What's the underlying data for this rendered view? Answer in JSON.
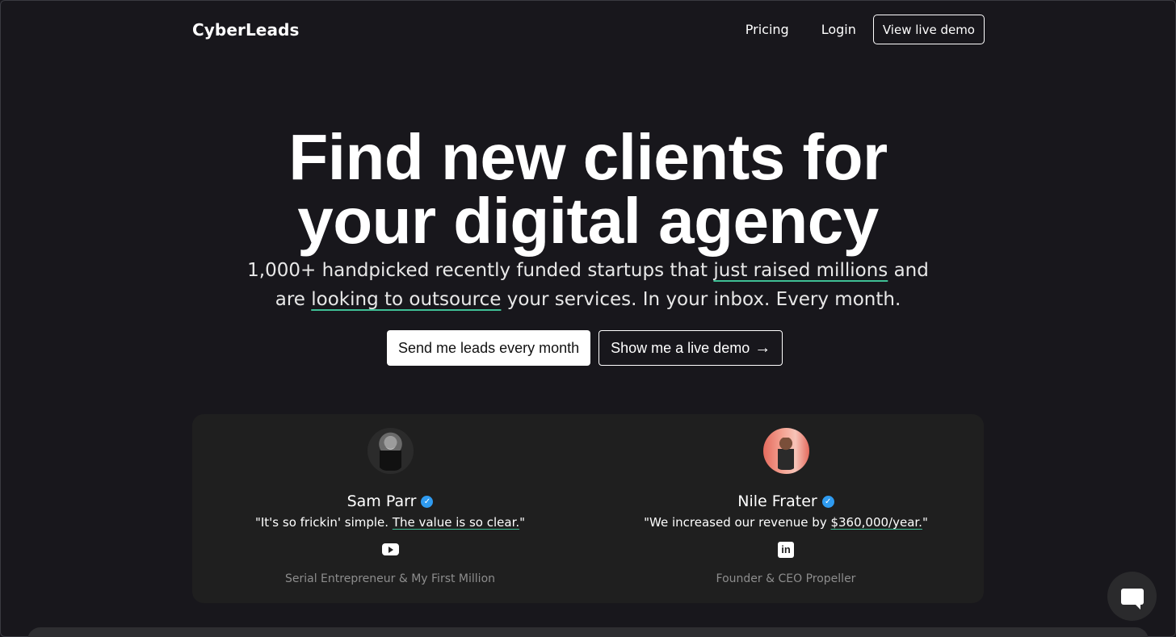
{
  "header": {
    "logo": "CyberLeads",
    "nav": [
      {
        "label": "Pricing"
      },
      {
        "label": "Login"
      }
    ],
    "demo_button": "View live demo"
  },
  "hero": {
    "title_line1": "Find new clients for",
    "title_line2": "your digital agency",
    "sub_part1": "1,000+ handpicked recently funded startups that ",
    "sub_highlight1": "just raised millions",
    "sub_part2": " and",
    "sub_part3": "are ",
    "sub_highlight2": "looking to outsource",
    "sub_part4": " your services. In your inbox. Every month.",
    "primary_cta": "Send me leads every month",
    "secondary_cta": "Show me a live demo",
    "secondary_cta_icon": "arrow-right-icon"
  },
  "testimonials": [
    {
      "name": "Sam Parr",
      "quote_start": "\"It's so frickin' simple. ",
      "quote_highlight": "The value is so clear.",
      "quote_end": "\"",
      "social_icon": "youtube-icon",
      "role": "Serial Entrepreneur & My First Million"
    },
    {
      "name": "Nile Frater",
      "quote_start": "\"We increased our revenue by ",
      "quote_highlight": "$360,000/year.",
      "quote_end": "\"",
      "social_icon": "linkedin-icon",
      "social_text": "in",
      "role": "Founder & CEO Propeller"
    }
  ],
  "verified_glyph": "✓",
  "arrow_glyph": "→",
  "colors": {
    "background": "#18171c",
    "card": "#1f1f1f",
    "accent_underline": "#3fbf95",
    "verified_badge": "#2f9bf0"
  }
}
